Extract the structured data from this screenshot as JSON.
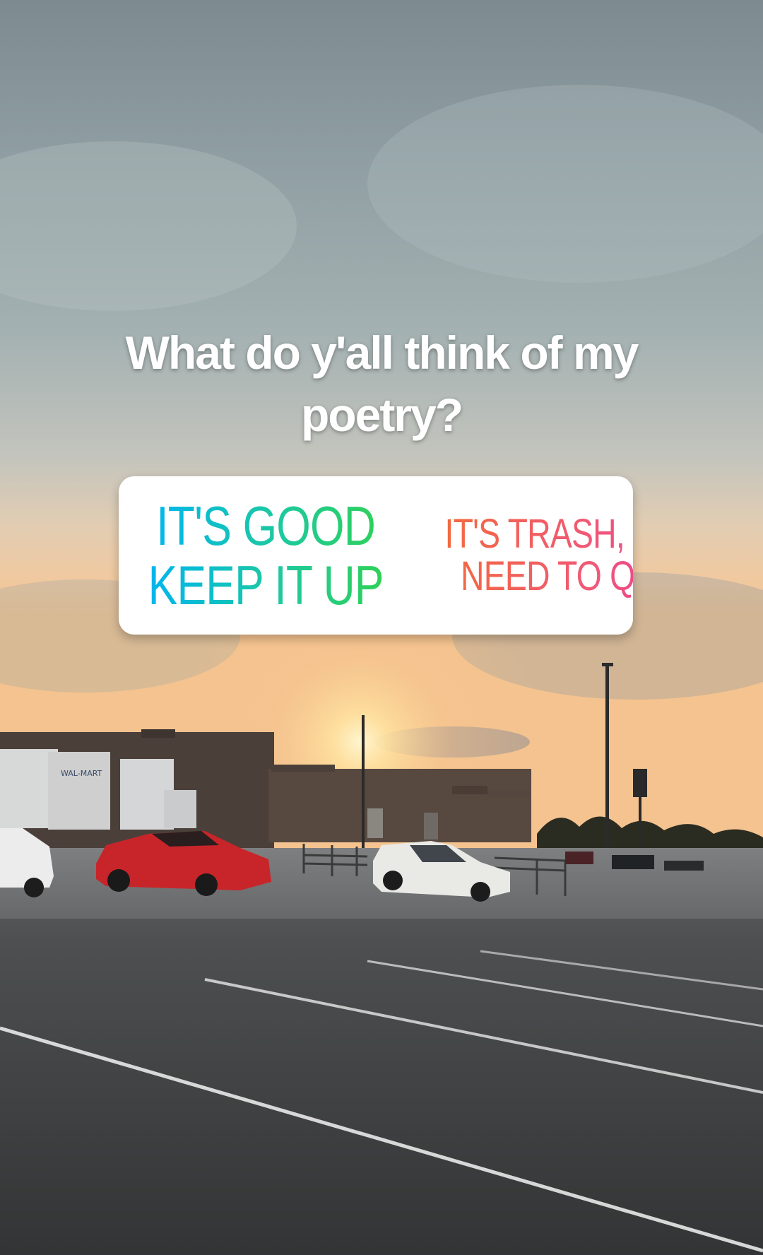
{
  "story": {
    "question": "What do y'all think of my poetry?",
    "poll": {
      "options": [
        {
          "label_line1": "IT'S GOOD",
          "label_line2": "KEEP IT UP"
        },
        {
          "label_line1": "IT'S TRASH, YOU",
          "label_line2": "NEED TO QUIT"
        }
      ]
    },
    "background_sign_text": "WAL-MART"
  },
  "colors": {
    "option_yes_gradient": [
      "#00b5f0",
      "#1dc9a0",
      "#2fd157"
    ],
    "option_no_gradient": [
      "#f26a3f",
      "#f0577a",
      "#e6349c"
    ],
    "poll_background": "#ffffff",
    "caption_text": "#ffffff"
  }
}
